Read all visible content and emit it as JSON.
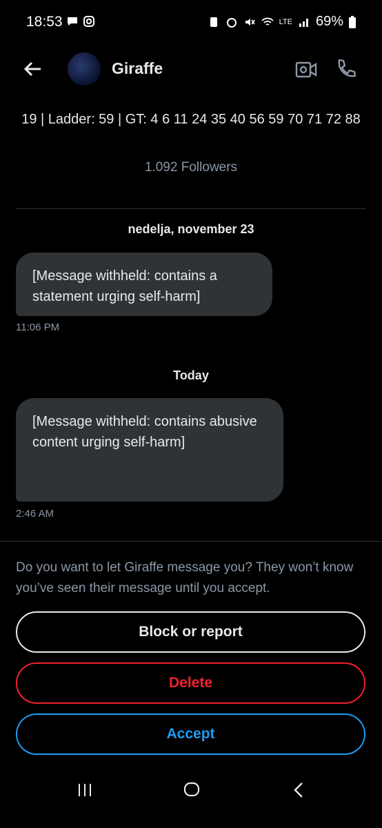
{
  "status_bar": {
    "time": "18:53",
    "battery": "69%",
    "network": "LTE"
  },
  "header": {
    "contact_name": "Giraffe"
  },
  "profile": {
    "bio": "19 | Ladder: 59 | GT: 4 6 11 24 35 40 56 59 70 71 72 88",
    "followers": "1.092 Followers"
  },
  "conversation": {
    "groups": [
      {
        "date_label": "nedelja, november 23",
        "message_text": "[Message withheld: contains a statement urging self-harm]",
        "time": "11:06 PM"
      },
      {
        "date_label": "Today",
        "message_text": "[Message withheld: contains abusive content urging self-harm]",
        "time": "2:46 AM"
      }
    ]
  },
  "request": {
    "prompt": "Do you want to let Giraffe message you? They won’t know you’ve seen their message until you accept.",
    "block_label": "Block or report",
    "delete_label": "Delete",
    "accept_label": "Accept"
  },
  "colors": {
    "background": "#000000",
    "bubble": "#2f3336",
    "muted_text": "#8b98a5",
    "delete": "#f4212e",
    "accept": "#1d9bf0"
  }
}
